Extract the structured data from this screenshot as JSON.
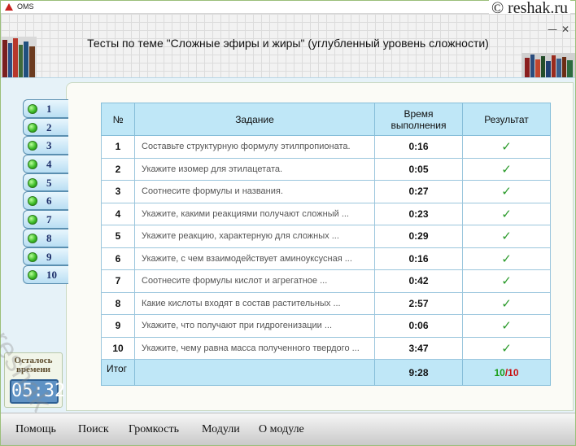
{
  "titlebar": {
    "app_name": "OMS"
  },
  "watermark": {
    "site": "© reshak.ru",
    "diagonal": "reshak.ru"
  },
  "header": {
    "title": "Тесты по теме \"Сложные эфиры и жиры\" (углубленный уровень сложности)",
    "minimize_glyph": "—",
    "close_glyph": "✕"
  },
  "sidebar": {
    "items": [
      "1",
      "2",
      "3",
      "4",
      "5",
      "6",
      "7",
      "8",
      "9",
      "10"
    ]
  },
  "table": {
    "headers": {
      "num": "№",
      "task": "Задание",
      "time": "Время выполнения",
      "result": "Результат"
    },
    "rows": [
      {
        "n": "1",
        "task": "Составьте структурную формулу этилпропионата.",
        "time": "0:16",
        "result": "✓"
      },
      {
        "n": "2",
        "task": "Укажите изомер для этилацетата.",
        "time": "0:05",
        "result": "✓"
      },
      {
        "n": "3",
        "task": "Соотнесите формулы и названия.",
        "time": "0:27",
        "result": "✓"
      },
      {
        "n": "4",
        "task": "Укажите, какими реакциями получают сложный ...",
        "time": "0:23",
        "result": "✓"
      },
      {
        "n": "5",
        "task": "Укажите реакцию, характерную для сложных ...",
        "time": "0:29",
        "result": "✓"
      },
      {
        "n": "6",
        "task": "Укажите, с чем взаимодействует аминоуксусная ...",
        "time": "0:16",
        "result": "✓"
      },
      {
        "n": "7",
        "task": "Соотнесите формулы кислот и агрегатное ...",
        "time": "0:42",
        "result": "✓"
      },
      {
        "n": "8",
        "task": "Какие кислоты входят в состав растительных ...",
        "time": "2:57",
        "result": "✓"
      },
      {
        "n": "9",
        "task": "Укажите, что получают при гидрогенизации ...",
        "time": "0:06",
        "result": "✓"
      },
      {
        "n": "10",
        "task": "Укажите, чему равна масса полученного твердого ...",
        "time": "3:47",
        "result": "✓"
      }
    ],
    "total": {
      "label": "Итог",
      "time": "9:28",
      "correct": "10",
      "sep": "/",
      "of": "10"
    }
  },
  "timer": {
    "label": "Осталось времени",
    "value": "05:32"
  },
  "menu": {
    "help": "Помощь",
    "search": "Поиск",
    "volume": "Громкость",
    "modules": "Модули",
    "about": "О модуле"
  },
  "colors": {
    "accent": "#bfe7f7",
    "check": "#2a9a2a",
    "score_ok": "#1a9e1a",
    "score_total": "#c81010"
  }
}
